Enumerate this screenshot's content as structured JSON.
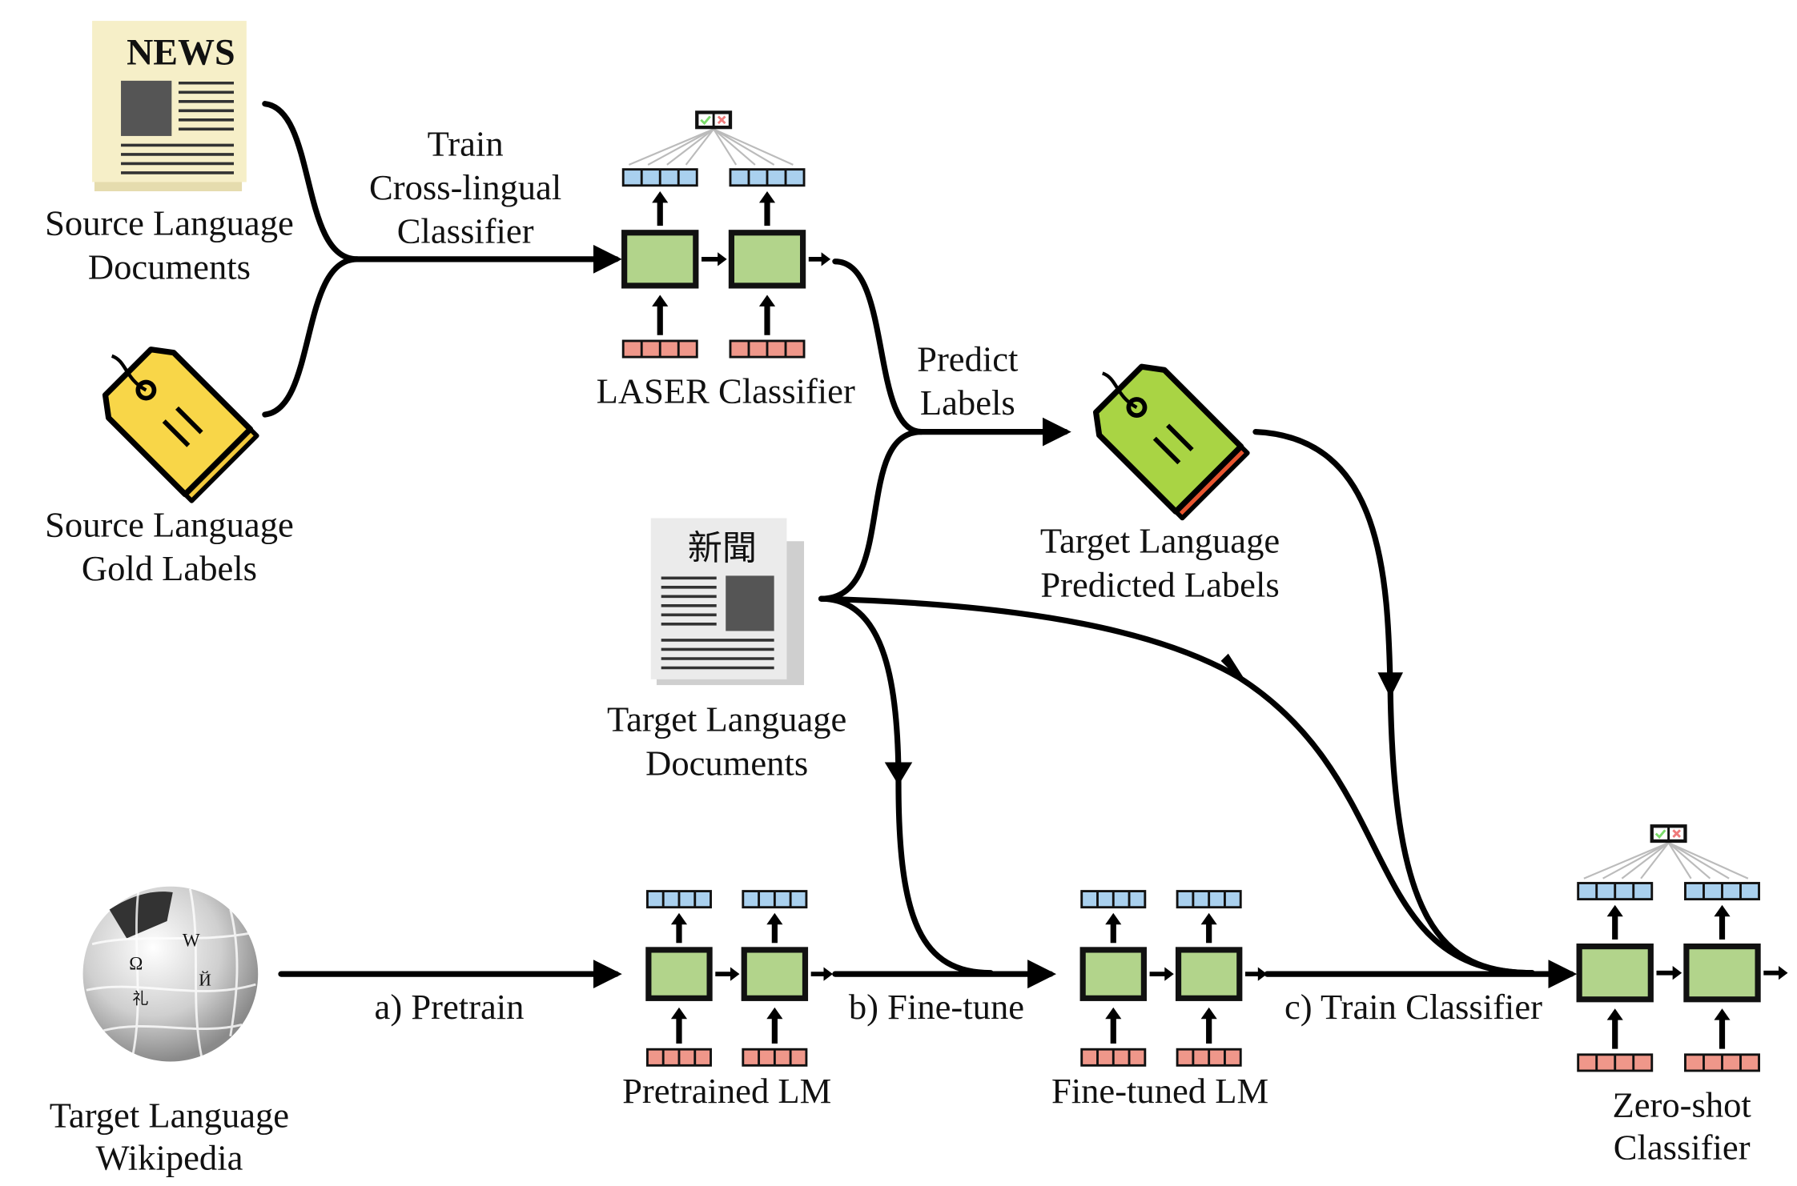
{
  "labels": {
    "source_docs": [
      "Source Language",
      "Documents"
    ],
    "source_labels": [
      "Source Language",
      "Gold Labels"
    ],
    "train_cross": [
      "Train",
      "Cross-lingual",
      "Classifier"
    ],
    "laser": "LASER Classifier",
    "predict": [
      "Predict",
      "Labels"
    ],
    "target_pred": [
      "Target Language",
      "Predicted Labels"
    ],
    "target_docs": [
      "Target Language",
      "Documents"
    ],
    "target_wiki": [
      "Target Language",
      "Wikipedia"
    ],
    "pretrain": "a) Pretrain",
    "pretrained_lm": "Pretrained LM",
    "finetune": "b) Fine-tune",
    "finetuned_lm": "Fine-tuned LM",
    "train_classifier": "c) Train Classifier",
    "zero_shot": [
      "Zero-shot",
      "Classifier"
    ]
  },
  "icons": {
    "news_masthead": "NEWS",
    "target_news_masthead": "新聞",
    "source_doc": "newspaper-icon",
    "target_doc": "newspaper-icon",
    "source_tag": "label-tag-icon",
    "target_tag": "label-tag-icon",
    "wiki": "wikipedia-globe-icon"
  },
  "colors": {
    "model_cell": "#b2d48b",
    "output_vector": "#a9d0ee",
    "input_vector": "#ef978a",
    "source_tag": "#f8d648",
    "target_tag": "#a9d444",
    "newspaper": "#f6efc8"
  }
}
